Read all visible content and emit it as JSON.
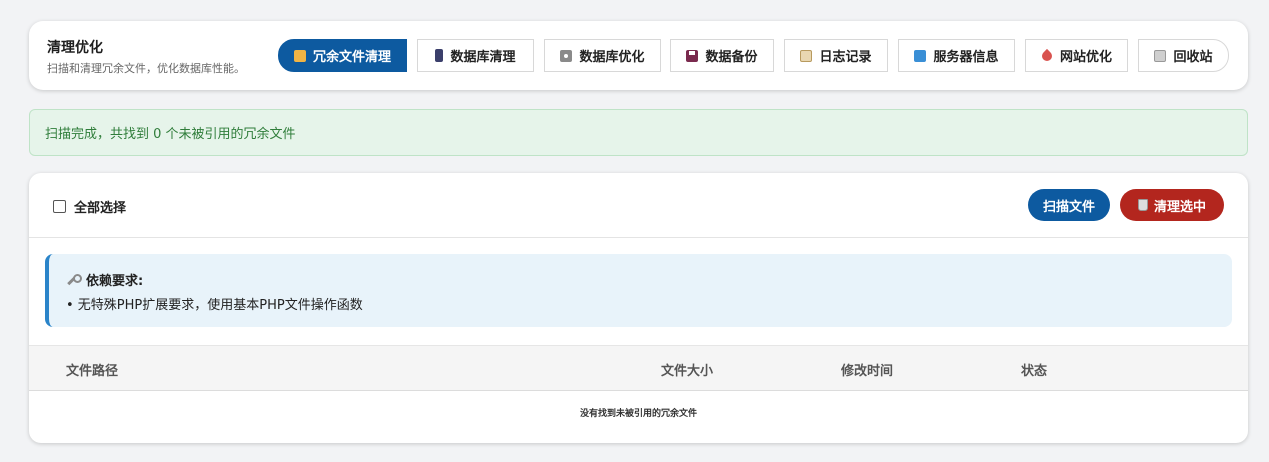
{
  "header": {
    "title": "清理优化",
    "subtitle": "扫描和清理冗余文件，优化数据库性能。"
  },
  "tabs": [
    {
      "label": "冗余文件清理",
      "icon": "folder-icon",
      "active": true
    },
    {
      "label": "数据库清理",
      "icon": "database-icon",
      "active": false
    },
    {
      "label": "数据库优化",
      "icon": "gear-icon",
      "active": false
    },
    {
      "label": "数据备份",
      "icon": "floppy-disk-icon",
      "active": false
    },
    {
      "label": "日志记录",
      "icon": "clipboard-icon",
      "active": false
    },
    {
      "label": "服务器信息",
      "icon": "server-icon",
      "active": false
    },
    {
      "label": "网站优化",
      "icon": "rocket-icon",
      "active": false
    },
    {
      "label": "回收站",
      "icon": "trash-icon",
      "active": false
    }
  ],
  "notice": {
    "text": "扫描完成，共找到 0 个未被引用的冗余文件"
  },
  "toolbar": {
    "select_all_label": "全部选择",
    "scan_label": "扫描文件",
    "clean_label": "清理选中"
  },
  "dependency": {
    "title": "依赖要求:",
    "item": "• 无特殊PHP扩展要求，使用基本PHP文件操作函数"
  },
  "table": {
    "columns": [
      "文件路径",
      "文件大小",
      "修改时间",
      "状态"
    ],
    "empty_message": "没有找到未被引用的冗余文件"
  },
  "colors": {
    "primary": "#0d5aa0",
    "danger": "#b3261e",
    "success_text": "#2f7d3a",
    "success_bg": "#e6f4ea",
    "info_bg": "#e8f3fa",
    "info_border": "#2a84c9"
  }
}
